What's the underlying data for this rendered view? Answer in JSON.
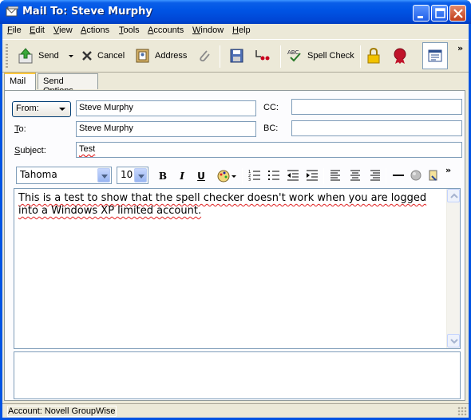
{
  "window": {
    "title": "Mail To: Steve Murphy"
  },
  "menu": [
    {
      "label": "File",
      "u": "F",
      "rest": "ile"
    },
    {
      "label": "Edit",
      "u": "E",
      "rest": "dit"
    },
    {
      "label": "View",
      "u": "V",
      "rest": "iew"
    },
    {
      "label": "Actions",
      "u": "A",
      "rest": "ctions"
    },
    {
      "label": "Tools",
      "u": "T",
      "rest": "ools"
    },
    {
      "label": "Accounts",
      "u": "A",
      "rest": "ccounts"
    },
    {
      "label": "Window",
      "u": "W",
      "rest": "indow"
    },
    {
      "label": "Help",
      "u": "H",
      "rest": "elp"
    }
  ],
  "toolbar": {
    "send": "Send",
    "cancel": "Cancel",
    "address": "Address",
    "spell_check": "Spell Check",
    "more": "»"
  },
  "tabs": [
    "Mail",
    "Send Options"
  ],
  "fields": {
    "from_label": "From:",
    "from_value": "Steve Murphy",
    "to_label": "To:",
    "to_value": "Steve Murphy",
    "cc_label": "CC:",
    "cc_value": "",
    "bc_label": "BC:",
    "bc_value": "",
    "subject_label": "Subject:",
    "subject_value": "Test"
  },
  "format": {
    "font": "Tahoma",
    "size": "10",
    "bold": "B",
    "italic": "I",
    "underline": "U",
    "more": "»"
  },
  "body_text": "This is a test to show that the spell checker doesn't work when you are logged into a Windows XP limited account.",
  "status": "Account: Novell GroupWise",
  "colors": {
    "title_bar": "#0054e3",
    "frame": "#ece9d8",
    "spell_error": "#e02020"
  }
}
